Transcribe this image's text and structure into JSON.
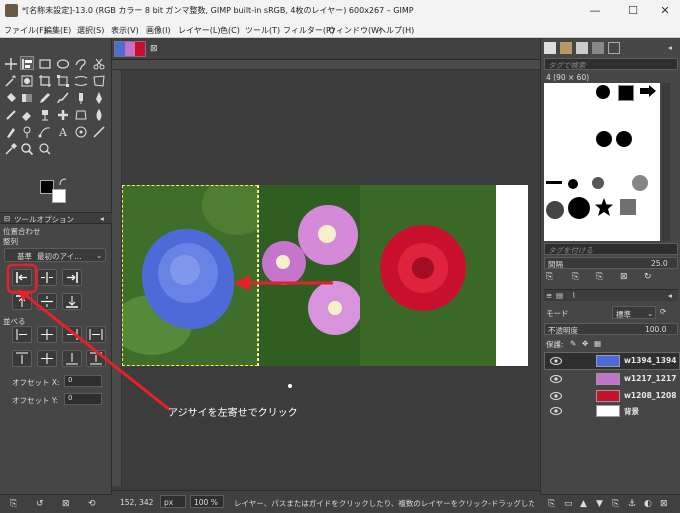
{
  "window": {
    "title": "*[名称未設定]-13.0 (RGB カラー 8 bit ガンマ整数, GIMP built-in sRGB, 4枚のレイヤー) 600x267 – GIMP",
    "minimize": "—",
    "maximize": "☐",
    "close": "✕"
  },
  "menu": {
    "items": [
      "ファイル(F)",
      "編集(E)",
      "選択(S)",
      "表示(V)",
      "画像(I)",
      "レイヤー(L)",
      "色(C)",
      "ツール(T)",
      "フィルター(R)",
      "ウィンドウ(W)",
      "ヘルプ(H)"
    ]
  },
  "tool_options": {
    "tab_label": "ツールオプション",
    "section_align": "位置合わせ",
    "section_align_sub": "整列",
    "relative_to_prefix": "基準",
    "relative_to_value": "最初のアイ…",
    "distribute_label": "並べる",
    "offset_x_label": "オフセット X:",
    "offset_x_value": "0",
    "offset_y_label": "オフセット Y:",
    "offset_y_value": "0"
  },
  "canvas": {
    "annotation": "アジサイを左寄せでクリック"
  },
  "status": {
    "coords": "152, 342",
    "unit": "px",
    "zoom": "100 %",
    "message": "レイヤー、パスまたはガイドをクリックしたり、複数のレイヤーをクリック-ドラッグしたりして整列対..."
  },
  "right_panel": {
    "brush_filter_placeholder": "タグで検索",
    "brush_name": "4 (90 × 60)",
    "tag_placeholder": "タグを付ける",
    "spacing_label": "間隔",
    "spacing_value": "25.0",
    "mode_label": "モード",
    "mode_value": "標準",
    "opacity_label": "不透明度",
    "opacity_value": "100.0",
    "lock_label": "保護:",
    "layers": [
      {
        "name": "w1394_1394"
      },
      {
        "name": "w1217_1217"
      },
      {
        "name": "w1208_1208"
      },
      {
        "name": "背景"
      }
    ]
  },
  "colors": {
    "accent_red": "#e8202a",
    "panel_bg": "#464646",
    "canvas_bg": "#3c3c3c"
  }
}
